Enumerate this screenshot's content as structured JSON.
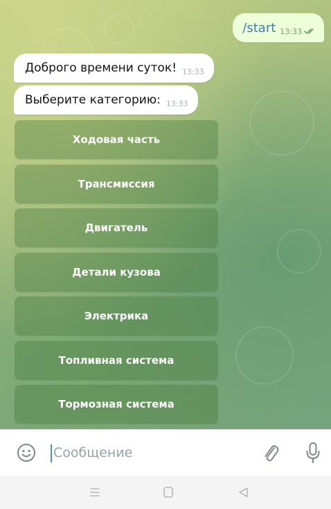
{
  "chat": {
    "outgoing": [
      {
        "text": "/start",
        "time": "13:33"
      }
    ],
    "incoming": [
      {
        "text": "Доброго времени суток!",
        "time": "13:33"
      },
      {
        "text": "Выберите категорию:",
        "time": "13:33"
      }
    ]
  },
  "keyboard": {
    "buttons": [
      "Ходовая часть",
      "Трансмиссия",
      "Двигатель",
      "Детали кузова",
      "Электрика",
      "Топливная система",
      "Тормозная система"
    ]
  },
  "input": {
    "placeholder": "Сообщение",
    "value": ""
  },
  "icons": {
    "emoji": "smile-icon",
    "attach": "paperclip-icon",
    "mic": "microphone-icon",
    "ticks": "double-check-icon",
    "nav": [
      "menu-icon",
      "home-icon",
      "back-icon"
    ]
  },
  "colors": {
    "outgoing_bubble": "#eefed9",
    "outgoing_text": "#3c7eb0",
    "outgoing_time": "#6aa56c",
    "incoming_bubble": "#ffffff",
    "keyboard_button": "#6a9a5c",
    "caret": "#4a8fd0"
  }
}
